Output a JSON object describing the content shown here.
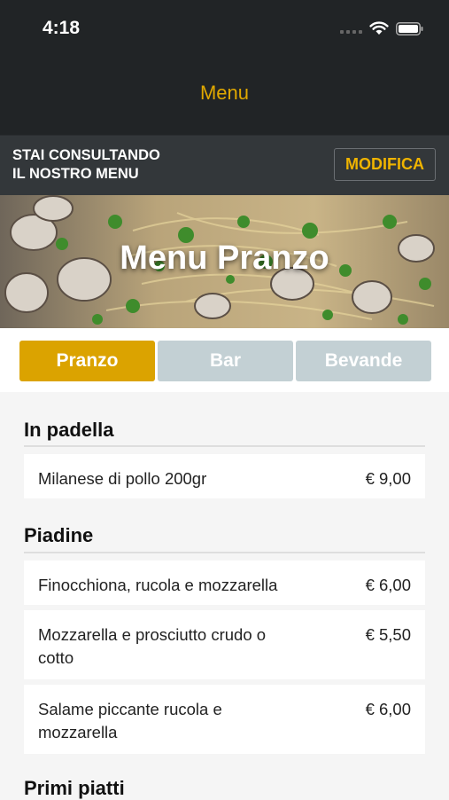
{
  "status_bar": {
    "time": "4:18"
  },
  "nav": {
    "title": "Menu"
  },
  "banner": {
    "line1": "STAI CONSULTANDO",
    "line2": "IL NOSTRO MENU",
    "button_label": "MODIFICA"
  },
  "hero": {
    "title": "Menu Pranzo"
  },
  "tabs": [
    {
      "label": "Pranzo",
      "active": true
    },
    {
      "label": "Bar",
      "active": false
    },
    {
      "label": "Bevande",
      "active": false
    }
  ],
  "sections": [
    {
      "title": "In padella",
      "items": [
        {
          "name": "Milanese di pollo 200gr",
          "price": "€ 9,00"
        }
      ]
    },
    {
      "title": "Piadine",
      "items": [
        {
          "name": "Finocchiona, rucola e mozzarella",
          "price": "€ 6,00"
        },
        {
          "name": "Mozzarella e prosciutto crudo o cotto",
          "price": "€ 5,50"
        },
        {
          "name": "Salame piccante rucola e mozzarella",
          "price": "€ 6,00"
        }
      ]
    },
    {
      "title": "Primi piatti",
      "items": []
    }
  ],
  "colors": {
    "accent": "#e0a800",
    "tab_active": "#dba300",
    "tab_inactive": "#c3d0d4",
    "dark_bg": "#212426"
  }
}
